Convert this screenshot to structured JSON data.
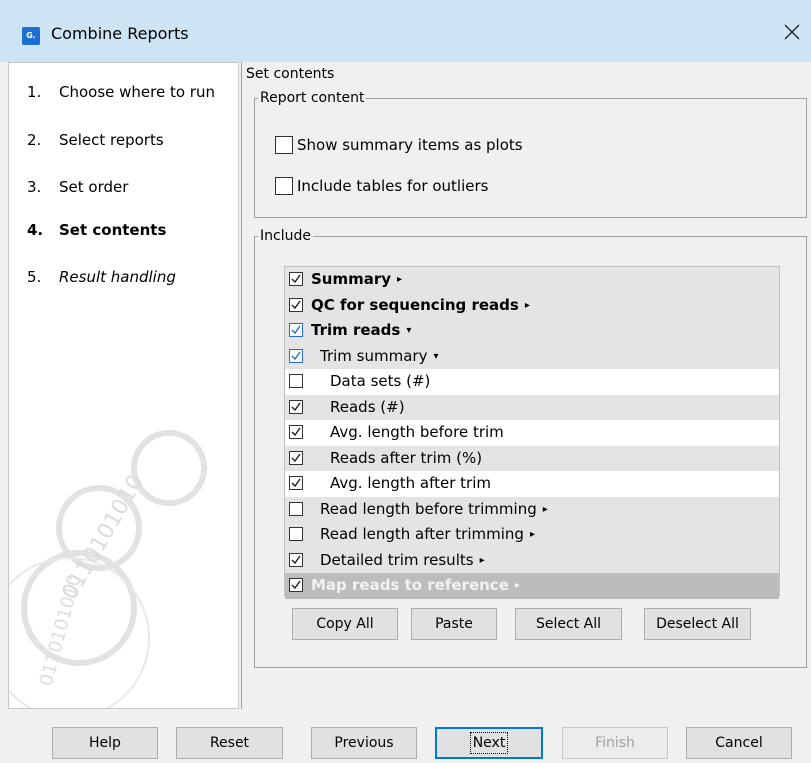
{
  "window": {
    "title": "Combine Reports",
    "app_icon_text": "G."
  },
  "steps": [
    {
      "num": "1.",
      "label": "Choose where to run"
    },
    {
      "num": "2.",
      "label": "Select reports"
    },
    {
      "num": "3.",
      "label": "Set order"
    },
    {
      "num": "4.",
      "label": "Set contents"
    },
    {
      "num": "5.",
      "label": "Result handling"
    }
  ],
  "page": {
    "title": "Set contents",
    "report_content": {
      "legend": "Report content",
      "options": [
        {
          "label": "Show summary items as plots",
          "checked": false
        },
        {
          "label": "Include tables for outliers",
          "checked": false
        }
      ]
    },
    "include": {
      "legend": "Include",
      "items": [
        {
          "label": "Summary",
          "checked": true,
          "arrow": "▸"
        },
        {
          "label": "QC for sequencing reads",
          "checked": true,
          "arrow": "▸"
        },
        {
          "label": "Trim reads",
          "checked": true,
          "arrow": "▾"
        },
        {
          "label": "Trim summary",
          "checked": true,
          "arrow": "▾"
        },
        {
          "label": "Data sets (#)",
          "checked": false,
          "arrow": ""
        },
        {
          "label": "Reads (#)",
          "checked": true,
          "arrow": ""
        },
        {
          "label": "Avg. length before trim",
          "checked": true,
          "arrow": ""
        },
        {
          "label": "Reads after trim (%)",
          "checked": true,
          "arrow": ""
        },
        {
          "label": "Avg. length after trim",
          "checked": true,
          "arrow": ""
        },
        {
          "label": "Read length before trimming",
          "checked": false,
          "arrow": "▸"
        },
        {
          "label": "Read length after trimming",
          "checked": false,
          "arrow": "▸"
        },
        {
          "label": "Detailed trim results",
          "checked": true,
          "arrow": "▸"
        },
        {
          "label": "Map reads to reference",
          "checked": true,
          "arrow": "▸"
        }
      ],
      "buttons": {
        "copy_all": "Copy All",
        "paste": "Paste",
        "select_all": "Select All",
        "deselect_all": "Deselect All"
      }
    }
  },
  "footer": {
    "help": "Help",
    "reset": "Reset",
    "previous": "Previous",
    "next": "Next",
    "finish": "Finish",
    "cancel": "Cancel"
  },
  "watermark_text": "0110101010"
}
